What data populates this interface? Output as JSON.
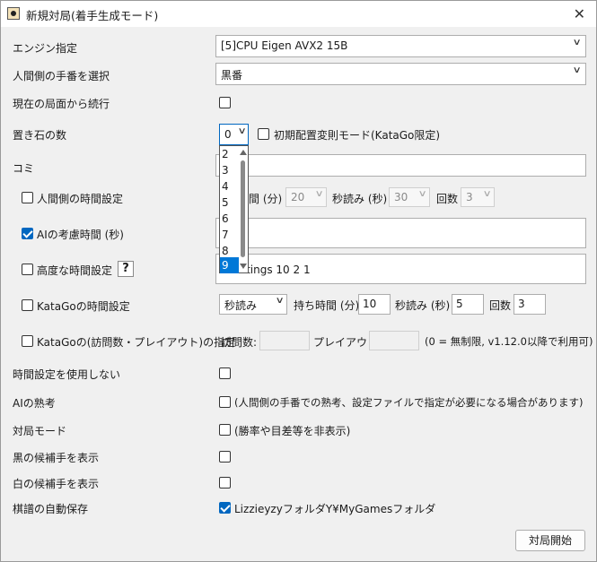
{
  "window": {
    "title": "新規対局(着手生成モード)"
  },
  "engine": {
    "label": "エンジン指定",
    "value": "[5]CPU Eigen AVX2 15B"
  },
  "player_side": {
    "label": "人間側の手番を選択",
    "value": "黒番"
  },
  "continue": {
    "label": "現在の局面から続行",
    "checked": false
  },
  "handicap": {
    "label": "置き石の数",
    "value": "0",
    "options": [
      "2",
      "3",
      "4",
      "5",
      "6",
      "7",
      "8",
      "9"
    ],
    "selected_option": "9",
    "initial_placement_label": "初期配置変則モード(KataGo限定)"
  },
  "komi": {
    "label": "コミ",
    "value": ""
  },
  "human_time": {
    "label": "人間側の時間設定",
    "checked": false,
    "main_label": "間 (分)",
    "main_value": "20",
    "byoyomi_label": "秒読み (秒)",
    "byoyomi_value": "30",
    "count_label": "回数",
    "count_value": "3"
  },
  "ai_time": {
    "label": "AIの考慮時間 (秒)",
    "checked": true,
    "value": ""
  },
  "advanced_time": {
    "label": "高度な時間設定",
    "checked": false,
    "help_label": "?",
    "value": "ettings 10 2 1"
  },
  "katago_time": {
    "label": "KataGoの時間設定",
    "checked": false,
    "mode": "秒読み",
    "main_label": "持ち時間 (分)",
    "main_value": "10",
    "byoyomi_label": "秒読み (秒)",
    "byoyomi_value": "5",
    "count_label": "回数",
    "count_value": "3"
  },
  "katago_visits": {
    "label": "KataGoの(訪問数・プレイアウト)の指定",
    "checked": false,
    "visits_label": "訪問数:",
    "visits_value": "",
    "playouts_label": "プレイアウト:",
    "playouts_value": "",
    "note": "(0 = 無制限, v1.12.0以降で利用可)"
  },
  "no_time": {
    "label": "時間設定を使用しない",
    "checked": false
  },
  "ai_ponder": {
    "label": "AIの熟考",
    "checked": false,
    "desc": "(人間側の手番での熟考、設定ファイルで指定が必要になる場合があります)"
  },
  "game_mode": {
    "label": "対局モード",
    "checked": false,
    "desc": "(勝率や目差等を非表示)"
  },
  "black_candidates": {
    "label": "黒の候補手を表示",
    "checked": false
  },
  "white_candidates": {
    "label": "白の候補手を表示",
    "checked": false
  },
  "autosave": {
    "label": "棋譜の自動保存",
    "checked": true,
    "desc": "LizzieyzyフォルダY¥MyGamesフォルダ"
  },
  "start_button": {
    "label": "対局開始"
  },
  "colors": {
    "accent": "#0067c0",
    "selection": "#0078d7",
    "background": "#f0f0f0"
  }
}
